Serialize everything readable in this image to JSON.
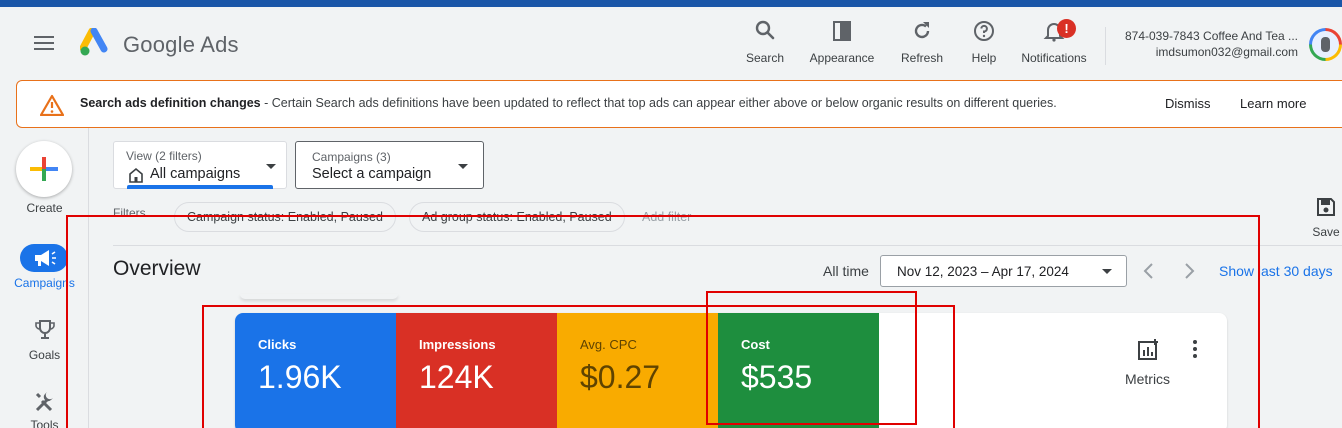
{
  "header": {
    "app_name": "Google Ads",
    "buttons": [
      {
        "label": "Search",
        "icon": "search-icon"
      },
      {
        "label": "Appearance",
        "icon": "appearance-icon"
      },
      {
        "label": "Refresh",
        "icon": "refresh-icon"
      },
      {
        "label": "Help",
        "icon": "help-icon"
      },
      {
        "label": "Notifications",
        "icon": "bell-icon",
        "badge": "!"
      }
    ],
    "account_line1": "874-039-7843 Coffee And Tea ...",
    "account_line2": "imdsumon032@gmail.com"
  },
  "banner": {
    "title": "Search ads definition changes",
    "message": " - Certain Search ads definitions have been updated to reflect that top ads can appear either above or below organic results on different queries.",
    "dismiss": "Dismiss",
    "learn_more": "Learn more",
    "accent_color": "#e8711a"
  },
  "leftnav": {
    "create": "Create",
    "campaigns": "Campaigns",
    "goals": "Goals",
    "tools": "Tools"
  },
  "selectors": {
    "view_small": "View (2 filters)",
    "view_value": "All campaigns",
    "campaigns_small": "Campaigns (3)",
    "campaigns_value": "Select a campaign"
  },
  "filters": {
    "label": "Filters",
    "chips": [
      "Campaign status: Enabled, Paused",
      "Ad group status: Enabled, Paused"
    ],
    "add_filter": "Add filter",
    "save": "Save"
  },
  "overview": {
    "title": "Overview",
    "all_time": "All time",
    "date_range": "Nov 12, 2023 – Apr 17, 2024",
    "show_last": "Show last 30 days"
  },
  "metrics": {
    "tiles": [
      {
        "label": "Clicks",
        "value": "1.96K",
        "color": "#1a73e8"
      },
      {
        "label": "Impressions",
        "value": "124K",
        "color": "#d93025"
      },
      {
        "label": "Avg. CPC",
        "value": "$0.27",
        "color": "#f9ab00"
      },
      {
        "label": "Cost",
        "value": "$535",
        "color": "#1e8e3e"
      }
    ],
    "metrics_label": "Metrics"
  }
}
